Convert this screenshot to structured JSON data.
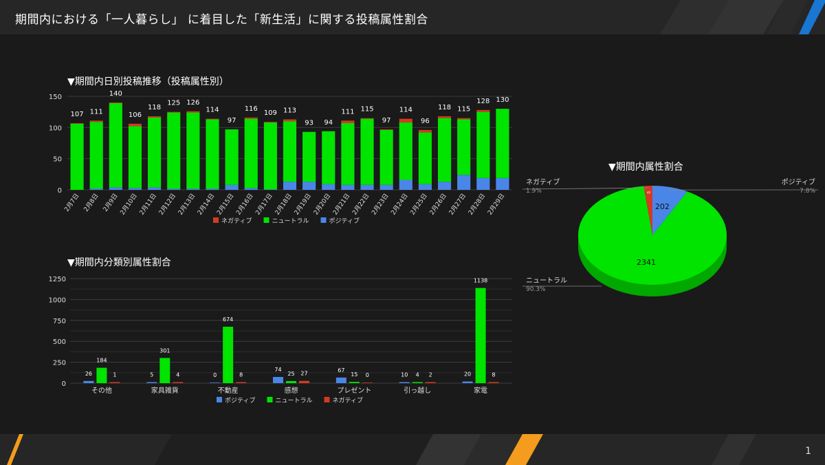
{
  "header": {
    "title": "期間内における「一人暮らし」 に着目した「新生活」に関する投稿属性割合"
  },
  "footer": {
    "page_number": "1"
  },
  "colors": {
    "negative": "#d23a24",
    "neutral": "#00e400",
    "positive": "#4a86e8",
    "background": "#1a1a1a",
    "accent_orange": "#f39c1d",
    "accent_blue": "#1976d2"
  },
  "chart_data": [
    {
      "type": "bar",
      "stacked": true,
      "title": "▼期間内日別投稿推移（投稿属性別）",
      "categories": [
        "2月7日",
        "2月8日",
        "2月9日",
        "2月10日",
        "2月11日",
        "2月12日",
        "2月13日",
        "2月14日",
        "2月15日",
        "2月16日",
        "2月17日",
        "2月18日",
        "2月19日",
        "2月20日",
        "2月21日",
        "2月22日",
        "2月23日",
        "2月24日",
        "2月25日",
        "2月26日",
        "2月27日",
        "2月28日",
        "2月29日"
      ],
      "totals": [
        107,
        111,
        140,
        106,
        118,
        125,
        126,
        114,
        97,
        116,
        109,
        113,
        93,
        94,
        111,
        115,
        97,
        114,
        96,
        118,
        115,
        128,
        130
      ],
      "series": [
        {
          "name": "ポジティブ",
          "values": [
            0,
            2,
            4,
            3,
            4,
            2,
            2,
            2,
            8,
            3,
            1,
            13,
            13,
            9,
            8,
            8,
            8,
            16,
            9,
            13,
            24,
            19,
            19
          ]
        },
        {
          "name": "ニュートラル",
          "values": [
            106,
            107,
            135,
            99,
            112,
            122,
            122,
            111,
            89,
            111,
            107,
            97,
            80,
            85,
            99,
            106,
            88,
            92,
            83,
            102,
            89,
            106,
            111
          ]
        },
        {
          "name": "ネガティブ",
          "values": [
            1,
            2,
            1,
            4,
            2,
            1,
            2,
            1,
            0,
            2,
            1,
            3,
            0,
            0,
            4,
            1,
            1,
            6,
            4,
            3,
            2,
            3,
            0
          ]
        }
      ],
      "legend": [
        "ネガティブ",
        "ニュートラル",
        "ポジティブ"
      ],
      "legend_position": "bottom",
      "yticks": [
        0,
        50,
        100,
        150
      ],
      "ylim": [
        0,
        150
      ]
    },
    {
      "type": "bar",
      "title": "▼期間内分類別属性割合",
      "categories": [
        "その他",
        "家具雑貨",
        "不動産",
        "感想",
        "プレゼント",
        "引っ越し",
        "家電"
      ],
      "series": [
        {
          "name": "ポジティブ",
          "values": [
            26,
            5,
            0,
            74,
            67,
            10,
            20
          ]
        },
        {
          "name": "ニュートラル",
          "values": [
            184,
            301,
            674,
            25,
            15,
            4,
            1138
          ]
        },
        {
          "name": "ネガティブ",
          "values": [
            1,
            4,
            8,
            27,
            0,
            2,
            8
          ]
        }
      ],
      "legend_position": "bottom",
      "yticks": [
        0,
        250,
        500,
        750,
        1000,
        1250
      ],
      "ylim": [
        0,
        1250
      ]
    },
    {
      "type": "pie",
      "title": "▼期間内属性割合",
      "slices": [
        {
          "name": "ポジティブ",
          "value": 202,
          "percent": "7.8%"
        },
        {
          "name": "ニュートラル",
          "value": 2341,
          "percent": "90.3%"
        },
        {
          "name": "ネガティブ",
          "value": 49,
          "percent": "1.9%"
        }
      ]
    }
  ]
}
